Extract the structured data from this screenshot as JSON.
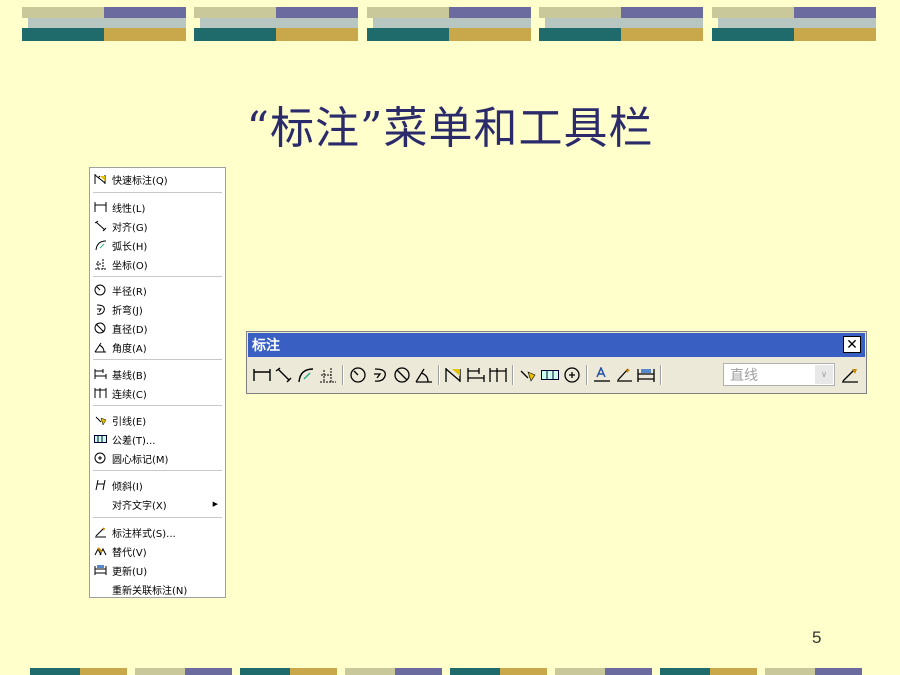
{
  "slide": {
    "title": "“标注”菜单和工具栏",
    "page_number": "5"
  },
  "colors": {
    "background": "#FFFFCC",
    "title": "#2B2B6B",
    "toolbar_title_bar": "#3A5FC3",
    "band_olive": "#C8C89A",
    "band_purple": "#6B6BA0",
    "band_teal": "#1F6B6B",
    "band_gold": "#C8A84A"
  },
  "menu": {
    "items": [
      {
        "label": "快速标注(Q)",
        "icon": "quick-dimension-icon"
      },
      {
        "label": "线性(L)",
        "icon": "linear-dimension-icon"
      },
      {
        "label": "对齐(G)",
        "icon": "aligned-dimension-icon"
      },
      {
        "label": "弧长(H)",
        "icon": "arc-length-icon"
      },
      {
        "label": "坐标(O)",
        "icon": "ordinate-icon"
      },
      {
        "label": "半径(R)",
        "icon": "radius-icon"
      },
      {
        "label": "折弯(J)",
        "icon": "jogged-icon"
      },
      {
        "label": "直径(D)",
        "icon": "diameter-icon"
      },
      {
        "label": "角度(A)",
        "icon": "angular-icon"
      },
      {
        "label": "基线(B)",
        "icon": "baseline-icon"
      },
      {
        "label": "连续(C)",
        "icon": "continue-icon"
      },
      {
        "label": "引线(E)",
        "icon": "leader-icon"
      },
      {
        "label": "公差(T)...",
        "icon": "tolerance-icon"
      },
      {
        "label": "圆心标记(M)",
        "icon": "center-mark-icon"
      },
      {
        "label": "倾斜(I)",
        "icon": "oblique-icon"
      },
      {
        "label": "对齐文字(X)",
        "icon": ""
      },
      {
        "label": "标注样式(S)...",
        "icon": "dimension-style-icon"
      },
      {
        "label": "替代(V)",
        "icon": "override-icon"
      },
      {
        "label": "更新(U)",
        "icon": "update-icon"
      },
      {
        "label": "重新关联标注(N)",
        "icon": ""
      }
    ]
  },
  "toolbar": {
    "title": "标注",
    "close_label": "✕",
    "style_select": {
      "value": "直线"
    },
    "buttons": [
      "linear-dimension-icon",
      "aligned-dimension-icon",
      "arc-length-icon",
      "ordinate-icon",
      "radius-icon",
      "jogged-icon",
      "diameter-icon",
      "angular-icon",
      "quick-dimension-icon",
      "baseline-icon",
      "continue-icon",
      "leader-icon",
      "tolerance-icon",
      "center-mark-icon",
      "dimension-edit-icon",
      "dimension-text-edit-icon",
      "update-icon",
      "dimension-style-icon"
    ]
  }
}
